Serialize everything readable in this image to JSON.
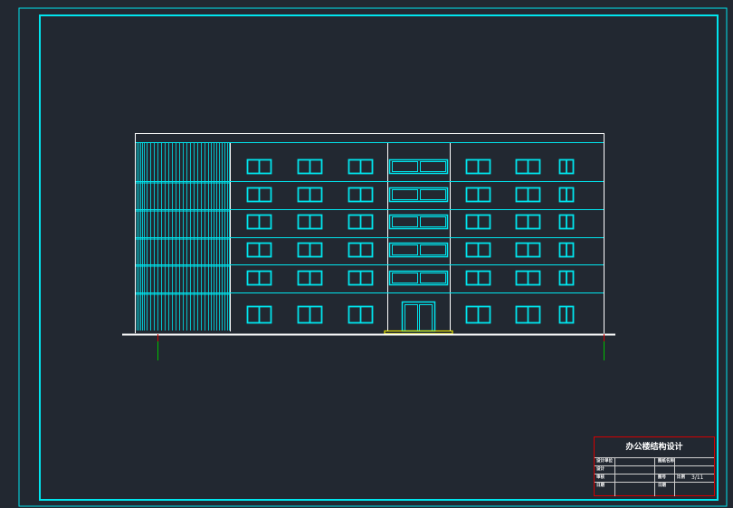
{
  "drawing": {
    "line_color": "#00e5ee",
    "white_color": "#ffffff",
    "ground_color": "#ffffff",
    "entrance_step_color": "#e6e600",
    "axis_color": "#00c000",
    "axis_tick_color": "#d40000",
    "frame_color": "#00e5ee",
    "background": "#222831"
  },
  "title_block": {
    "title": "办公楼结构设计",
    "border_color": "#d40000",
    "rows": [
      {
        "label_1": "设计单位",
        "label_2": "图纸名称"
      },
      {
        "label_1": "设计",
        "label_2": ""
      },
      {
        "label_1": "审核",
        "label_2": "图号",
        "label_3": "比例",
        "sheet": "3/11"
      },
      {
        "label_1": "日期",
        "label_2": "日期"
      }
    ]
  }
}
